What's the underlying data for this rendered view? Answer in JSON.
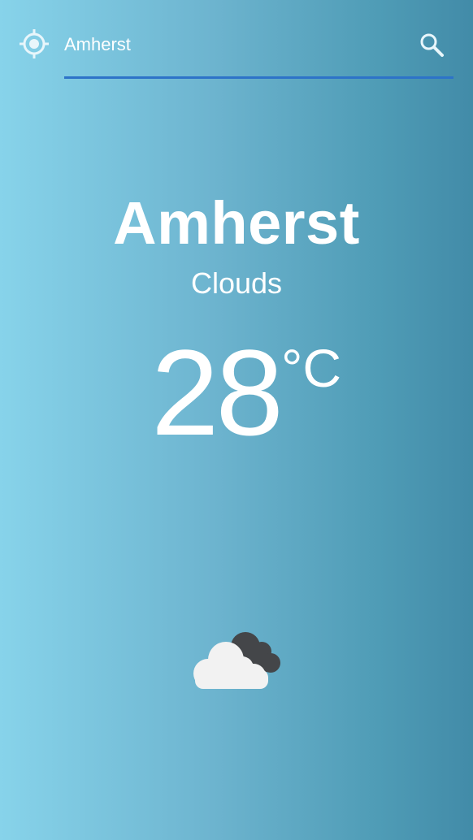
{
  "search": {
    "value": "Amherst",
    "locate_icon": "crosshair-gps-icon",
    "search_icon": "magnifier-search-icon",
    "underline_color": "#2d73c8"
  },
  "weather": {
    "city": "Amherst",
    "condition": "Clouds",
    "temperature": "28",
    "unit": "°C",
    "icon": "clouds-icon"
  },
  "colors": {
    "background_left": "#87d3ea",
    "background_right": "#428ba8",
    "text": "#ffffff"
  }
}
